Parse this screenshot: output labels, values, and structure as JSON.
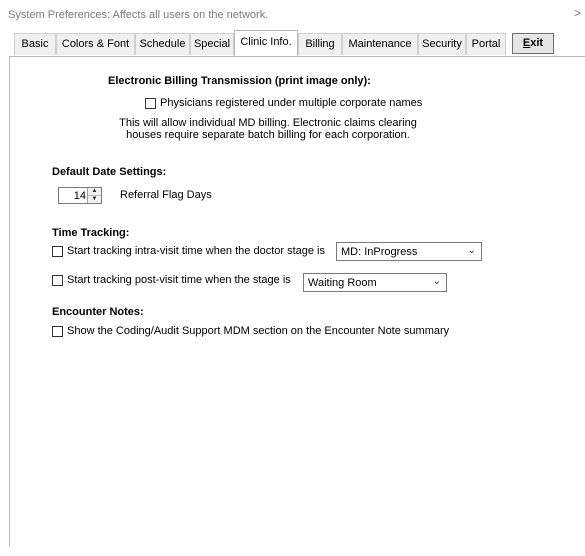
{
  "window": {
    "title": "System Preferences: Affects all users on the network.",
    "close_glyph": ">"
  },
  "tabs": [
    {
      "label": "Basic"
    },
    {
      "label": "Colors & Font"
    },
    {
      "label": "Schedule"
    },
    {
      "label": "Special"
    },
    {
      "label": "Clinic Info."
    },
    {
      "label": "Billing"
    },
    {
      "label": "Maintenance"
    },
    {
      "label": "Security"
    },
    {
      "label": "Portal"
    }
  ],
  "active_tab": "Clinic Info.",
  "exit_button": {
    "label_prefix": "E",
    "label_rest": "xit"
  },
  "ebt": {
    "heading": "Electronic Billing Transmission (print image only):",
    "checkbox_label": "Physicians registered under multiple corporate names",
    "checked": false,
    "note_line1": "This will allow individual MD billing. Electronic claims clearing",
    "note_line2": "houses require separate batch billing for each corporation."
  },
  "date_settings": {
    "heading": "Default Date Settings:",
    "referral_days": "14",
    "referral_label": "Referral Flag Days"
  },
  "time_tracking": {
    "heading": "Time Tracking:",
    "intra_label": "Start tracking intra-visit time when the doctor stage is",
    "intra_checked": false,
    "intra_value": "MD: InProgress",
    "post_label": "Start tracking post-visit time when the stage is",
    "post_checked": false,
    "post_value": "Waiting Room"
  },
  "encounter_notes": {
    "heading": "Encounter Notes:",
    "mdm_label": "Show the Coding/Audit Support MDM section on the Encounter Note summary",
    "mdm_checked": false
  },
  "icons": {
    "close": "close-icon",
    "spin_up": "spin-up-icon",
    "spin_down": "spin-down-icon",
    "dropdown": "chevron-down-icon"
  },
  "colors": {
    "panel_border": "#b8b8b8",
    "inactive_tab_bg": "#f0f0f0",
    "title_text": "#7a7a7a"
  }
}
